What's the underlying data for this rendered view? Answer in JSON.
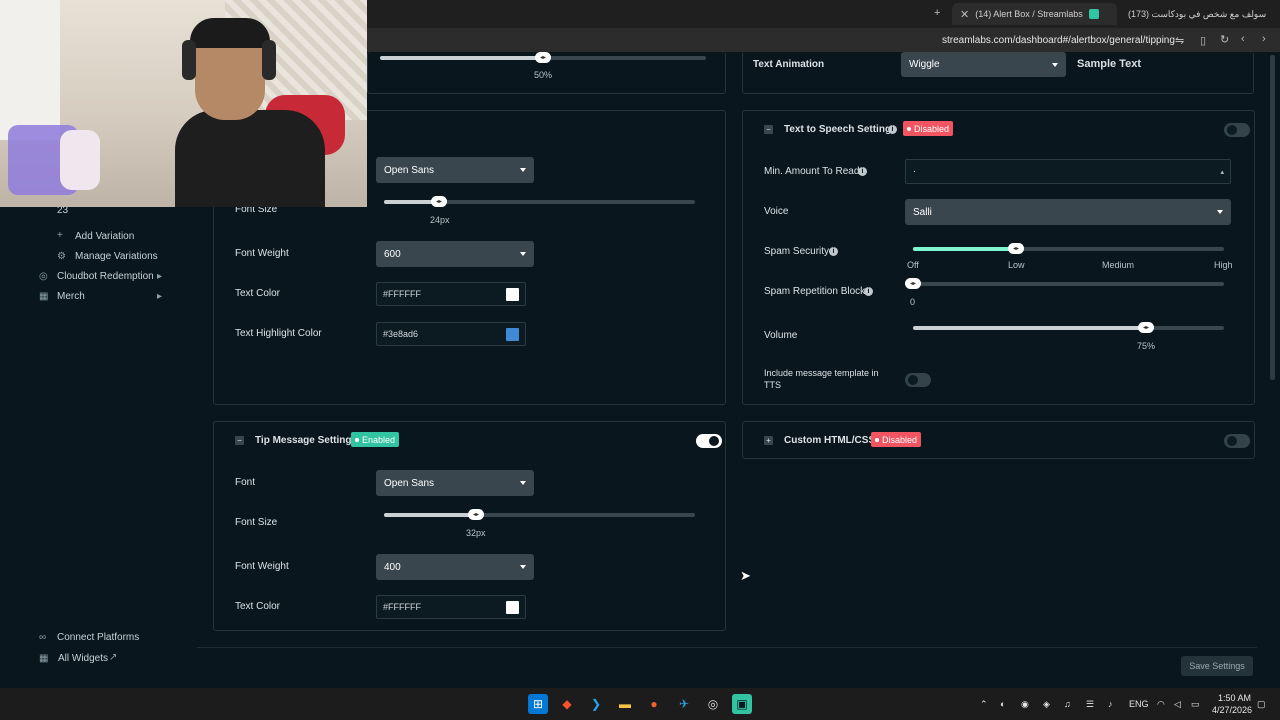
{
  "browser": {
    "tabs": [
      {
        "label": "(14) Alert Box / Streamlabs",
        "active": true
      },
      {
        "label": "(173) سولف مع شخص في بودكاست",
        "active": false
      }
    ],
    "url": "streamlabs.com/dashboard#/alertbox/general/tipping"
  },
  "sidebar": {
    "count_label": "23",
    "items": [
      {
        "label": "Add Variation",
        "icon": "plus-icon"
      },
      {
        "label": "Manage Variations",
        "icon": "gear-icon"
      },
      {
        "label": "Cloudbot Redemption",
        "icon": "chat-icon"
      },
      {
        "label": "Merch",
        "icon": "merch-icon"
      }
    ],
    "bottom": [
      {
        "label": "Connect Platforms",
        "icon": "link-icon"
      },
      {
        "label": "All Widgets",
        "icon": "grid-icon"
      }
    ]
  },
  "top_left_panel": {
    "slider_value_label": "50%",
    "slider_fraction": 0.5
  },
  "top_right_panel": {
    "text_animation_label": "Text Animation",
    "text_animation_value": "Wiggle",
    "sample_text": "Sample Text"
  },
  "name_settings": {
    "font_value": "Open Sans",
    "font_size_label": "Font Size",
    "font_size_value": "24px",
    "font_size_fraction": 0.17,
    "font_weight_label": "Font Weight",
    "font_weight_value": "600",
    "text_color_label": "Text Color",
    "text_color_value": "#FFFFFF",
    "text_color_swatch": "#FFFFFF",
    "highlight_label": "Text Highlight Color",
    "highlight_value": "#3e8ad6",
    "highlight_swatch": "#3e8ad6"
  },
  "tts": {
    "title": "Text to Speech Settings",
    "status": "Disabled",
    "min_amount_label": "Min. Amount To Read",
    "min_amount_value": "٠",
    "voice_label": "Voice",
    "voice_value": "Salli",
    "spam_security_label": "Spam Security",
    "spam_security_ticks": [
      "Off",
      "Low",
      "Medium",
      "High"
    ],
    "spam_security_level": "Low",
    "spam_repetition_label": "Spam Repetition Block",
    "spam_repetition_value": "0",
    "volume_label": "Volume",
    "volume_value": "75%",
    "volume_fraction": 0.75,
    "include_template_label_1": "Include message template in",
    "include_template_label_2": "TTS"
  },
  "tip_message": {
    "title": "Tip Message Settings",
    "status": "Enabled",
    "font_label": "Font",
    "font_value": "Open Sans",
    "font_size_label": "Font Size",
    "font_size_value": "32px",
    "font_size_fraction": 0.3,
    "font_weight_label": "Font Weight",
    "font_weight_value": "400",
    "text_color_label": "Text Color",
    "text_color_value": "#FFFFFF",
    "text_color_swatch": "#FFFFFF"
  },
  "custom_html": {
    "title": "Custom HTML/CSS",
    "status": "Disabled"
  },
  "footer": {
    "save_label": "Save Settings"
  },
  "taskbar": {
    "lang": "ENG",
    "time": "1:50 AM",
    "date": "4/27/2026"
  },
  "colors": {
    "background": "#09161d",
    "accent_green": "#80f5d2",
    "disabled_red": "#f25562",
    "enabled_green": "#31c3a2"
  }
}
